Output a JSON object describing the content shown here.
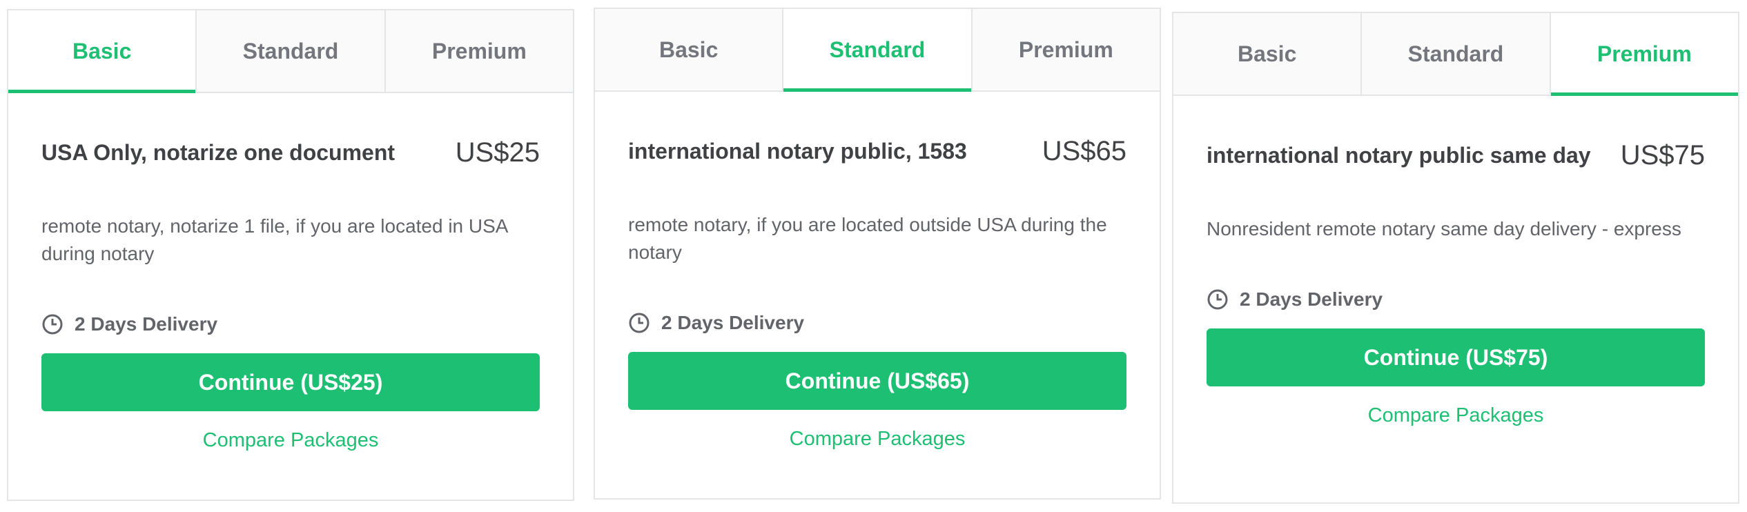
{
  "cards": [
    {
      "tabs": [
        "Basic",
        "Standard",
        "Premium"
      ],
      "active_tab": "Basic",
      "title": "USA Only, notarize one document",
      "price": "US$25",
      "description": "remote notary, notarize 1 file, if you are located in USA during notary",
      "delivery": "2 Days Delivery",
      "cta": "Continue (US$25)",
      "compare": "Compare Packages"
    },
    {
      "tabs": [
        "Basic",
        "Standard",
        "Premium"
      ],
      "active_tab": "Standard",
      "title": "international notary public, 1583",
      "price": "US$65",
      "description": "remote notary, if you are located outside USA during the notary",
      "delivery": "2 Days Delivery",
      "cta": "Continue (US$65)",
      "compare": "Compare Packages"
    },
    {
      "tabs": [
        "Basic",
        "Standard",
        "Premium"
      ],
      "active_tab": "Premium",
      "title": "international notary public same day",
      "price": "US$75",
      "description": "Nonresident remote notary same day delivery - express",
      "delivery": "2 Days Delivery",
      "cta": "Continue (US$75)",
      "compare": "Compare Packages"
    }
  ],
  "colors": {
    "accent": "#1dbf73",
    "text": "#404145",
    "muted": "#62646a",
    "tab_text": "#74767e",
    "border": "#e4e5e7"
  }
}
